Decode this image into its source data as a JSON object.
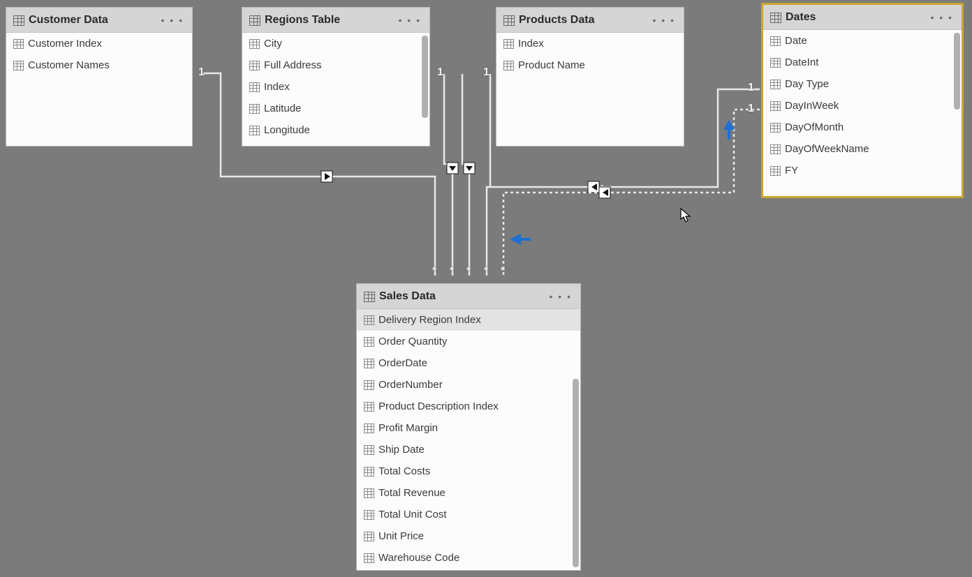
{
  "tables": {
    "customer": {
      "title": "Customer Data",
      "fields": [
        "Customer Index",
        "Customer Names"
      ]
    },
    "regions": {
      "title": "Regions Table",
      "fields": [
        "City",
        "Full Address",
        "Index",
        "Latitude",
        "Longitude"
      ]
    },
    "products": {
      "title": "Products Data",
      "fields": [
        "Index",
        "Product Name"
      ]
    },
    "dates": {
      "title": "Dates",
      "fields": [
        "Date",
        "DateInt",
        "Day Type",
        "DayInWeek",
        "DayOfMonth",
        "DayOfWeekName",
        "FY"
      ]
    },
    "sales": {
      "title": "Sales Data",
      "fields": [
        "Delivery Region Index",
        "Order Quantity",
        "OrderDate",
        "OrderNumber",
        "Product Description Index",
        "Profit Margin",
        "Ship Date",
        "Total Costs",
        "Total Revenue",
        "Total Unit Cost",
        "Unit Price",
        "Warehouse Code"
      ]
    }
  },
  "cardinality": {
    "one": "1",
    "many": "*"
  }
}
